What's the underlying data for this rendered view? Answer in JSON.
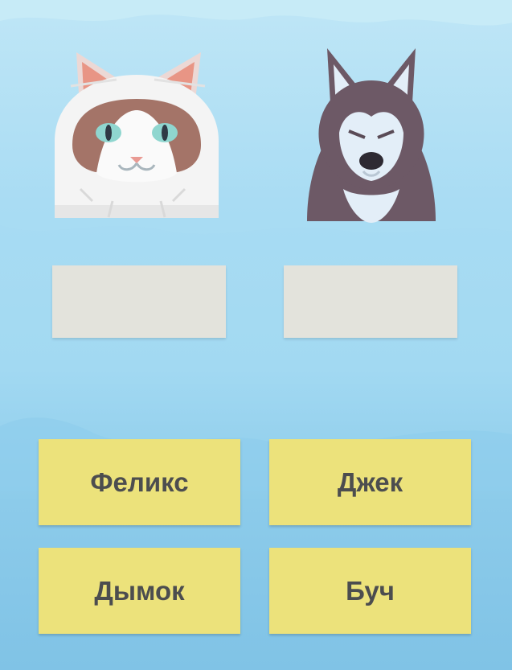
{
  "pets": [
    {
      "icon": "cat-face-icon"
    },
    {
      "icon": "husky-dog-icon"
    }
  ],
  "name_options": [
    "Феликс",
    "Джек",
    "Дымок",
    "Буч"
  ],
  "colors": {
    "button": "#ece27b",
    "drop_slot": "#e3e3dc",
    "text": "#4c4d4f",
    "background": "#a9dcf3"
  }
}
